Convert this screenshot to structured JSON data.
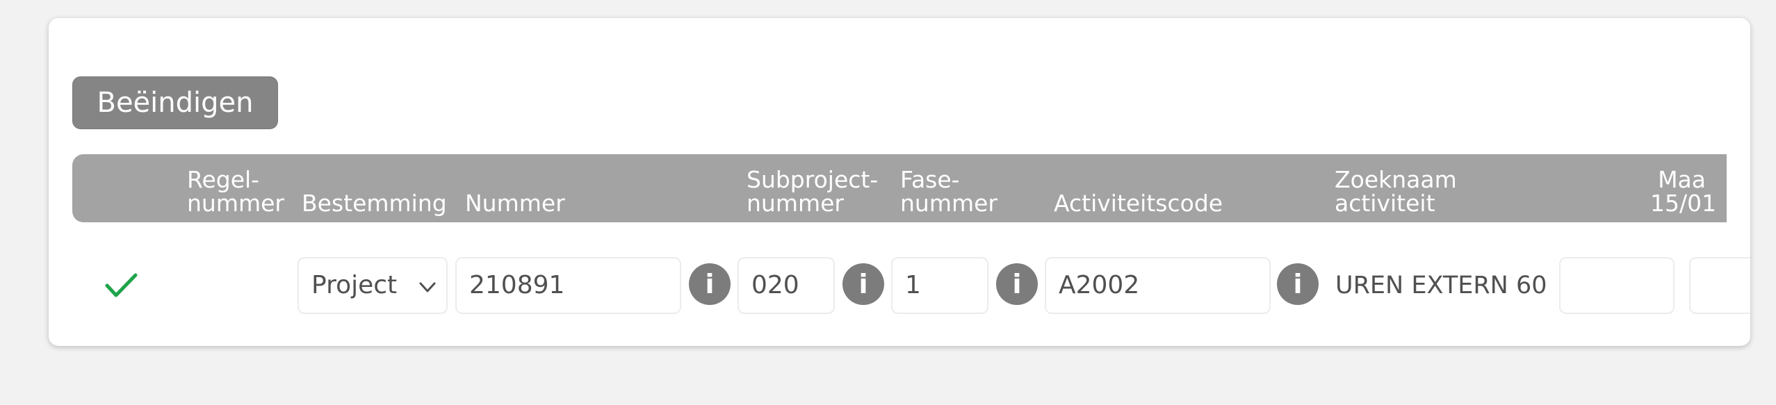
{
  "actions": {
    "end_label": "Beëindigen"
  },
  "table": {
    "headers": {
      "regelnummer": "Regel-\nnummer",
      "bestemming": "Bestemming",
      "nummer": "Nummer",
      "subprojectnummer": "Subproject-\nnummer",
      "fasenummer": "Fase-\nnummer",
      "activiteitscode": "Activiteitscode",
      "zoeknaam": "Zoeknaam\nactiviteit",
      "maandag": "Maa\n15/01"
    },
    "row": {
      "status_icon": "checkmark-icon",
      "bestemming": "Project",
      "nummer": "210891",
      "subprojectnummer": "020",
      "fasenummer": "1",
      "activiteitscode": "A2002",
      "zoeknaam": "UREN EXTERN 60",
      "maandag": "",
      "next_day": "",
      "info_glyph": "i"
    }
  },
  "colors": {
    "header_bg": "#a3a3a3",
    "button_bg": "#858585",
    "check_green": "#1fa34a",
    "info_bg": "#7c7c7c"
  }
}
